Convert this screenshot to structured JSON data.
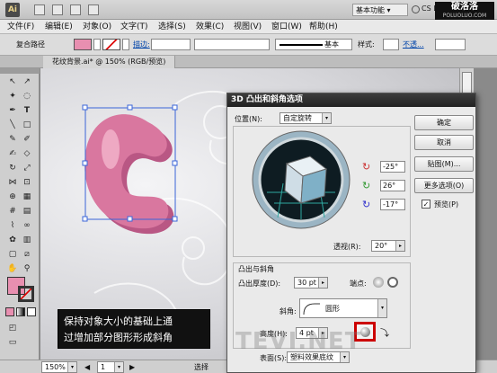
{
  "app": {
    "logo": "Ai",
    "workspace": "基本功能 ▾",
    "cs_live": "CS Live ▾"
  },
  "brand": {
    "line1": "破洛洛",
    "line2": "POLUOLUO.COM"
  },
  "menu": [
    "文件(F)",
    "编辑(E)",
    "对象(O)",
    "文字(T)",
    "选择(S)",
    "效果(C)",
    "视图(V)",
    "窗口(W)",
    "帮助(H)"
  ],
  "control": {
    "selection_label": "复合路径",
    "stroke_label": "描边:",
    "stroke_profile": "基本",
    "style_label": "样式:",
    "opacity_label": "不透..."
  },
  "doc_tab": "花纹背景.ai* @ 150% (RGB/预览)",
  "status": {
    "zoom": "150%",
    "page": "1",
    "mode": "选择"
  },
  "dialog": {
    "title": "3D 凸出和斜角选项",
    "position_label": "位置(N):",
    "position_value": "自定旋转",
    "rot_x": "-25°",
    "rot_y": "26°",
    "rot_z": "-17°",
    "perspective_label": "透视(R):",
    "perspective_value": "20°",
    "extrude_section": "凸出与斜角",
    "depth_label": "凸出厚度(D):",
    "depth_value": "30 pt",
    "cap_label": "端点:",
    "bevel_label": "斜角:",
    "bevel_value": "圆形",
    "height_label": "高度(H):",
    "height_value": "4 pt",
    "surface_label": "表面(S):",
    "surface_value": "塑料效果底纹",
    "buttons": {
      "ok": "确定",
      "cancel": "取消",
      "map": "贴图(M)...",
      "more": "更多选项(O)",
      "preview": "预览(P)"
    }
  },
  "callout": {
    "line1": "保持对象大小的基础上通",
    "line2": "过增加部分图形形成斜角"
  },
  "watermark": "TEVI.NET",
  "colors": {
    "fill_swatch": "#e88fb0",
    "shape": "#d06a94",
    "cube_front": "#cfdde6",
    "cube_side": "#7fb0c7",
    "highlight": "#cc0000"
  }
}
